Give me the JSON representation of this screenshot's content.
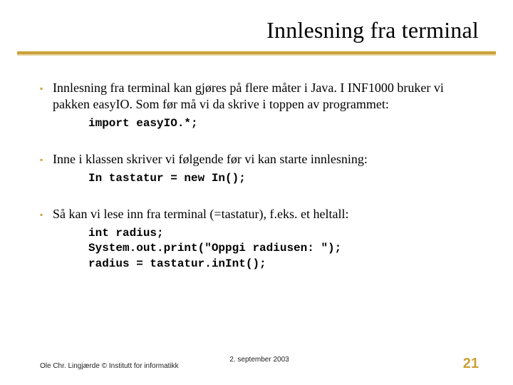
{
  "title": "Innlesning fra terminal",
  "bullets": [
    {
      "text": "Innlesning fra terminal kan gjøres på flere måter i Java.  I INF1000 bruker vi pakken easyIO.  Som før må vi da skrive i toppen av programmet:",
      "code": "import easyIO.*;"
    },
    {
      "text": "Inne i klassen skriver vi følgende før vi kan starte innlesning:",
      "code": "In tastatur = new In();"
    },
    {
      "text": "Så kan vi lese inn fra terminal (=tastatur), f.eks. et heltall:",
      "code": "int radius;\nSystem.out.print(\"Oppgi radiusen: \");\nradius = tastatur.inInt();"
    }
  ],
  "footer": {
    "left": "Ole Chr. Lingjærde © Institutt for informatikk",
    "center": "2. september 2003",
    "right": "21"
  },
  "glyphs": {
    "bullet": "▪"
  }
}
